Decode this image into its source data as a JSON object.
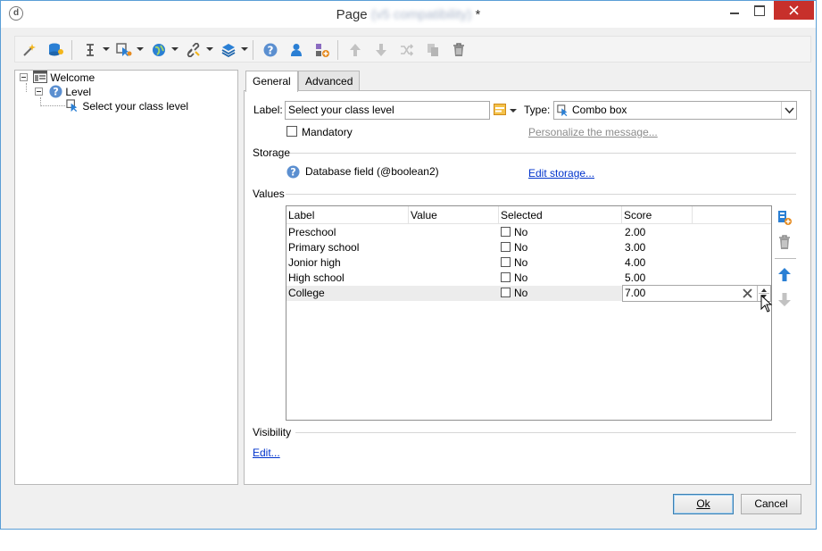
{
  "window": {
    "title_prefix": "Page",
    "title_blurred": "(v5 compatibility)",
    "title_suffix": "*",
    "app_icon": "d"
  },
  "toolbar": {
    "icons": [
      "wand-icon",
      "database-user-icon",
      "text-cursor-icon",
      "cursor-gear-icon",
      "globe-icon",
      "link-icon",
      "layers-icon",
      "help-icon",
      "user-icon",
      "shapes-add-icon",
      "arrow-up-icon",
      "arrow-down-icon",
      "shuffle-icon",
      "copy-icon",
      "trash-icon"
    ]
  },
  "tree": {
    "root": "Welcome",
    "child": "Level",
    "leaf": "Select your class level"
  },
  "tabs": {
    "general": "General",
    "advanced": "Advanced"
  },
  "form": {
    "label_caption": "Label:",
    "label_value": "Select your class level",
    "type_caption": "Type:",
    "type_value": "Combo box",
    "mandatory_label": "Mandatory",
    "personalize_link": "Personalize the message..."
  },
  "storage": {
    "section": "Storage",
    "field": "Database field (@boolean2)",
    "edit_link": "Edit storage..."
  },
  "values": {
    "section": "Values",
    "columns": [
      "Label",
      "Value",
      "Selected",
      "Score"
    ],
    "rows": [
      {
        "label": "Preschool",
        "value": "",
        "selected": "No",
        "score": "2.00"
      },
      {
        "label": "Primary school",
        "value": "",
        "selected": "No",
        "score": "3.00"
      },
      {
        "label": "Jonior high",
        "value": "",
        "selected": "No",
        "score": "4.00"
      },
      {
        "label": "High school",
        "value": "",
        "selected": "No",
        "score": "5.00"
      },
      {
        "label": "College",
        "value": "",
        "selected": "No",
        "score": "7.00"
      }
    ]
  },
  "visibility": {
    "section": "Visibility",
    "edit_link": "Edit..."
  },
  "buttons": {
    "ok": "Ok",
    "cancel": "Cancel"
  },
  "colors": {
    "accent": "#3a8fd9",
    "link": "#0033cc",
    "close": "#c7302b",
    "help": "#5b8fd0"
  }
}
